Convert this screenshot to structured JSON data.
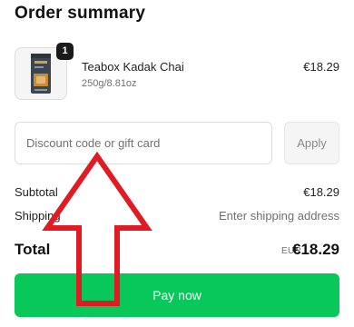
{
  "header": {
    "title": "Order summary"
  },
  "product": {
    "quantity_badge": "1",
    "name": "Teabox Kadak Chai",
    "variant": "250g/8.81oz",
    "price": "€18.29"
  },
  "discount": {
    "placeholder": "Discount code or gift card",
    "apply_label": "Apply"
  },
  "summary": {
    "subtotal_label": "Subtotal",
    "subtotal_value": "€18.29",
    "shipping_label": "Shipping",
    "shipping_value": "Enter shipping address",
    "total_label": "Total",
    "total_currency": "EUR",
    "total_value": "€18.29"
  },
  "actions": {
    "pay_label": "Pay now"
  },
  "colors": {
    "pay_button": "#09c85a",
    "annotation_arrow": "#e01b24"
  }
}
